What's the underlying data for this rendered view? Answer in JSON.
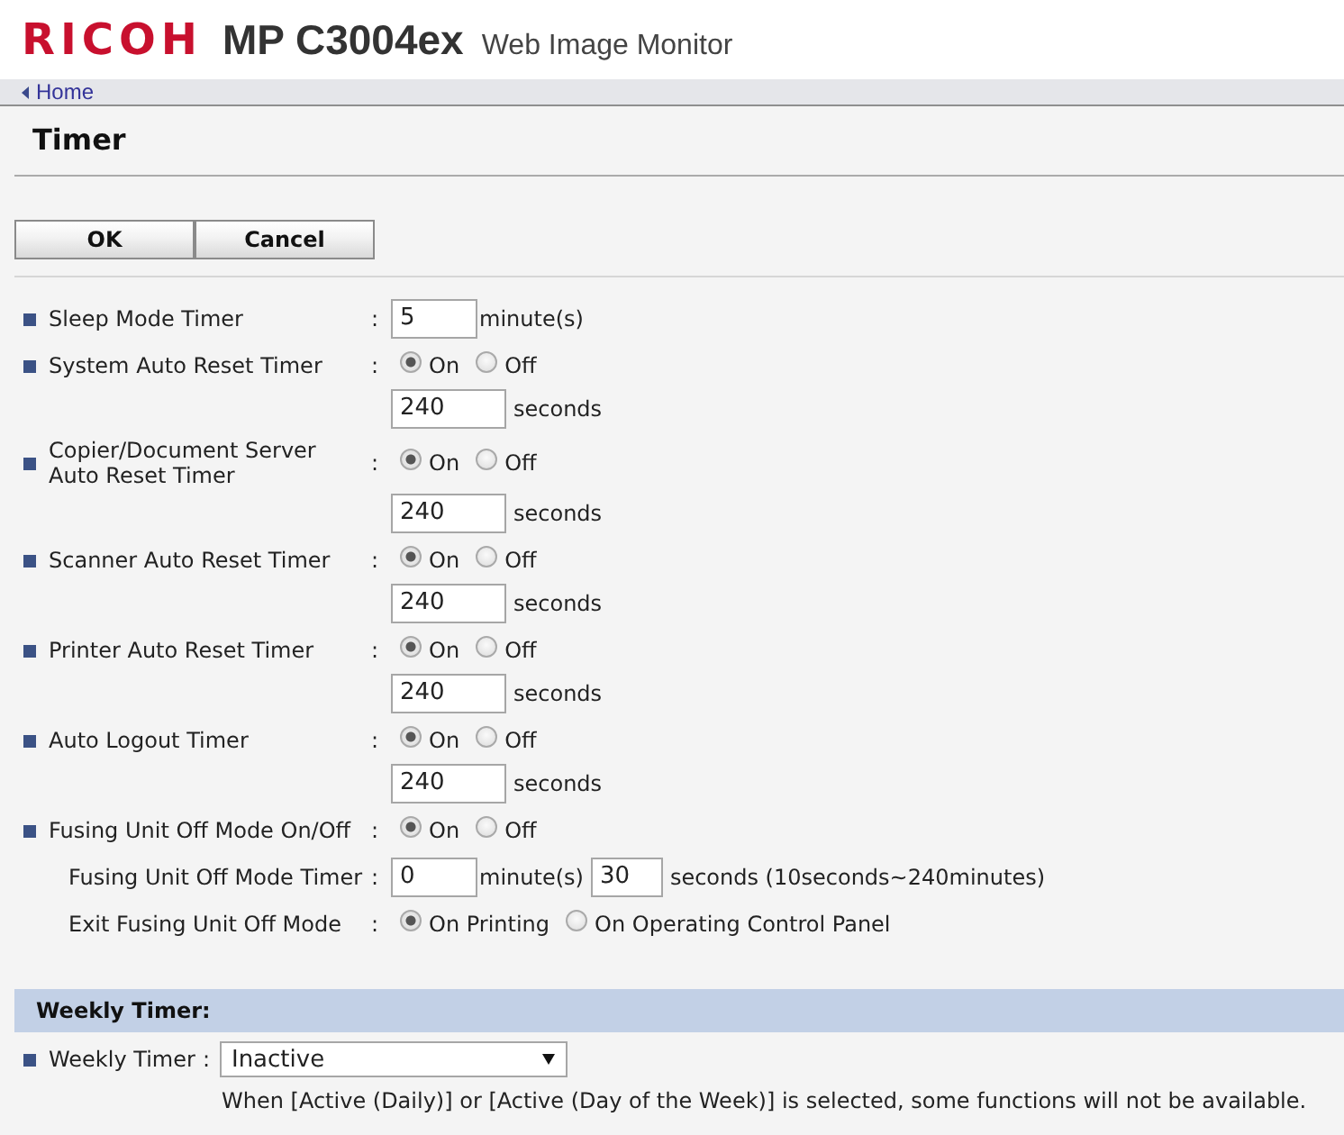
{
  "header": {
    "brand": "RICOH",
    "model": "MP C3004ex",
    "product": "Web Image Monitor"
  },
  "breadcrumb": {
    "link": "Home"
  },
  "page_title": "Timer",
  "buttons": [
    {
      "label": "OK"
    },
    {
      "label": "Cancel"
    }
  ],
  "settings": [
    {
      "kind": "number",
      "label": "Sleep Mode Timer",
      "separator": ":",
      "value": "5",
      "unit": "minute(s)"
    },
    {
      "kind": "options",
      "label": "System Auto Reset Timer",
      "separator": ":",
      "options": [
        {
          "label": "On",
          "selected": true
        },
        {
          "label": "Off",
          "selected": false
        }
      ],
      "value": "240",
      "unit": "seconds"
    },
    {
      "kind": "options",
      "label": "Copier/Document Server Auto Reset Timer",
      "separator": ":",
      "options": [
        {
          "label": "On",
          "selected": true
        },
        {
          "label": "Off",
          "selected": false
        }
      ],
      "value": "240",
      "unit": "seconds"
    },
    {
      "kind": "options",
      "label": "Scanner Auto Reset Timer",
      "separator": ":",
      "options": [
        {
          "label": "On",
          "selected": true
        },
        {
          "label": "Off",
          "selected": false
        }
      ],
      "value": "240",
      "unit": "seconds"
    },
    {
      "kind": "options",
      "label": "Printer Auto Reset Timer",
      "separator": ":",
      "options": [
        {
          "label": "On",
          "selected": true
        },
        {
          "label": "Off",
          "selected": false
        }
      ],
      "value": "240",
      "unit": "seconds"
    },
    {
      "kind": "options",
      "label": "Auto Logout Timer",
      "separator": ":",
      "options": [
        {
          "label": "On",
          "selected": true
        },
        {
          "label": "Off",
          "selected": false
        }
      ],
      "value": "240",
      "unit": "seconds"
    },
    {
      "kind": "options",
      "label": "Fusing Unit Off Mode On/Off",
      "separator": ":",
      "options": [
        {
          "label": "On",
          "selected": true
        },
        {
          "label": "Off",
          "selected": false
        }
      ],
      "children": [
        {
          "kind": "duration",
          "label": "Fusing Unit Off Mode Timer",
          "separator": ":",
          "fields": [
            {
              "value": "0",
              "unit": "minute(s)"
            },
            {
              "value": "30",
              "unit": "seconds (10seconds~240minutes)"
            }
          ]
        },
        {
          "kind": "options",
          "label": "Exit Fusing Unit Off Mode",
          "separator": ":",
          "options": [
            {
              "label": "On Printing",
              "selected": true
            },
            {
              "label": "On Operating Control Panel",
              "selected": false
            }
          ]
        }
      ]
    }
  ],
  "weekly_section": {
    "title": "Weekly Timer:",
    "label": "Weekly Timer",
    "separator": ":",
    "select": {
      "value": "Inactive"
    },
    "note": "When [Active (Daily)] or [Active (Day of the Week)] is selected, some functions will not be available."
  }
}
